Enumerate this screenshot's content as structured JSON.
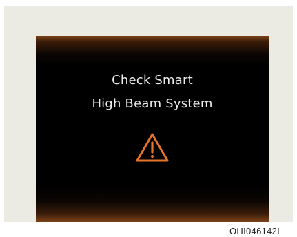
{
  "display": {
    "message_line1": "Check Smart",
    "message_line2": "High Beam System",
    "icon": "warning-triangle-icon",
    "icon_color": "#e8742a",
    "text_color": "#ececec",
    "glow_color": "#7c4319"
  },
  "figure": {
    "code": "OHI046142L"
  }
}
